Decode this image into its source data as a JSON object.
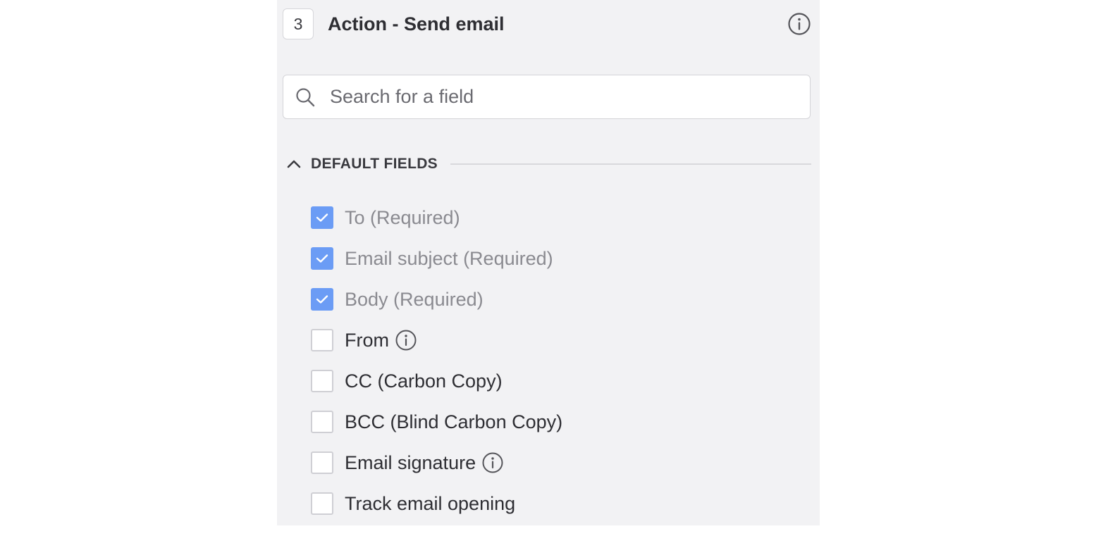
{
  "header": {
    "step_number": "3",
    "title": "Action - Send email",
    "info_icon": "info-icon"
  },
  "search": {
    "placeholder": "Search for a field",
    "value": "",
    "icon": "search-icon"
  },
  "section": {
    "label": "DEFAULT FIELDS",
    "expanded": true,
    "icon": "chevron-up-icon"
  },
  "fields": [
    {
      "label": "To (Required)",
      "checked": true,
      "disabled": true,
      "info": false
    },
    {
      "label": "Email subject (Required)",
      "checked": true,
      "disabled": true,
      "info": false
    },
    {
      "label": "Body (Required)",
      "checked": true,
      "disabled": true,
      "info": false
    },
    {
      "label": "From",
      "checked": false,
      "disabled": false,
      "info": true
    },
    {
      "label": "CC (Carbon Copy)",
      "checked": false,
      "disabled": false,
      "info": false
    },
    {
      "label": "BCC (Blind Carbon Copy)",
      "checked": false,
      "disabled": false,
      "info": false
    },
    {
      "label": "Email signature",
      "checked": false,
      "disabled": false,
      "info": true
    },
    {
      "label": "Track email opening",
      "checked": false,
      "disabled": false,
      "info": false
    }
  ],
  "colors": {
    "panel_bg": "#f2f2f4",
    "checkbox_checked": "#6b9cf5",
    "text_primary": "#2e2e33",
    "text_disabled": "#8a8a90"
  }
}
